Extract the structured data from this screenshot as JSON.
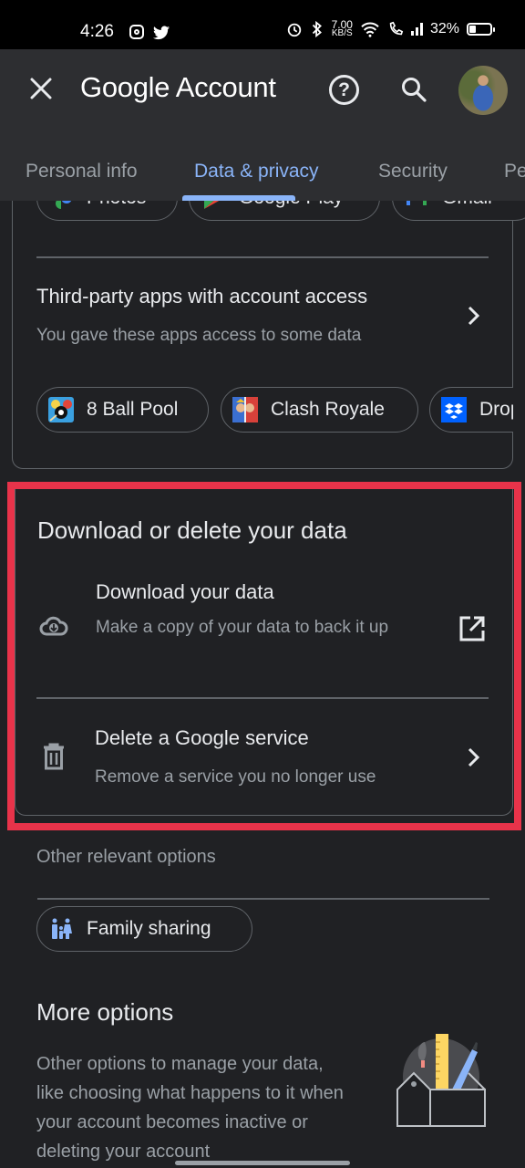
{
  "status_bar": {
    "time": "4:26",
    "notification_icons": [
      "instagram-icon",
      "twitter-icon"
    ],
    "net_speed_value": "7.00",
    "net_speed_unit": "KB/S",
    "battery_percent": "32%",
    "battery_level": 0.32
  },
  "app_bar": {
    "title": "Google Account",
    "close_icon": "close-icon",
    "help_icon": "help-icon",
    "help_glyph": "?",
    "search_icon": "search-icon",
    "avatar": "profile-photo"
  },
  "tabs": [
    {
      "label": "Personal info",
      "active": false
    },
    {
      "label": "Data & privacy",
      "active": true
    },
    {
      "label": "Security",
      "active": false
    },
    {
      "label": "People & sharing",
      "active": false
    }
  ],
  "accent_color": "#8ab4f8",
  "highlight_color": "#e8334a",
  "service_chips": [
    {
      "label": "Photos",
      "icon": "google-photos-icon"
    },
    {
      "label": "Google Play",
      "icon": "google-play-icon"
    },
    {
      "label": "Gmail",
      "icon": "gmail-icon"
    }
  ],
  "third_party": {
    "title": "Third-party apps with account access",
    "subtitle": "You gave these apps access to some data",
    "apps": [
      {
        "label": "8 Ball Pool",
        "icon": "8-ball-pool-icon"
      },
      {
        "label": "Clash Royale",
        "icon": "clash-royale-icon"
      },
      {
        "label": "Dropbox",
        "icon": "dropbox-icon"
      }
    ]
  },
  "download_delete": {
    "heading": "Download or delete your data",
    "items": [
      {
        "title": "Download your data",
        "subtitle": "Make a copy of your data to back it up",
        "icon": "cloud-download-icon",
        "action_icon": "open-in-new-icon"
      },
      {
        "title": "Delete a Google service",
        "subtitle": "Remove a service you no longer use",
        "icon": "trash-icon",
        "action_icon": "chevron-right-icon"
      }
    ]
  },
  "other_options": {
    "label": "Other relevant options",
    "chips": [
      {
        "label": "Family sharing",
        "icon": "family-icon"
      }
    ]
  },
  "more_options": {
    "heading": "More options",
    "body": "Other options to manage your data, like choosing what happens to it when your account becomes inactive or deleting your account",
    "illustration": "toolbox-illustration"
  }
}
